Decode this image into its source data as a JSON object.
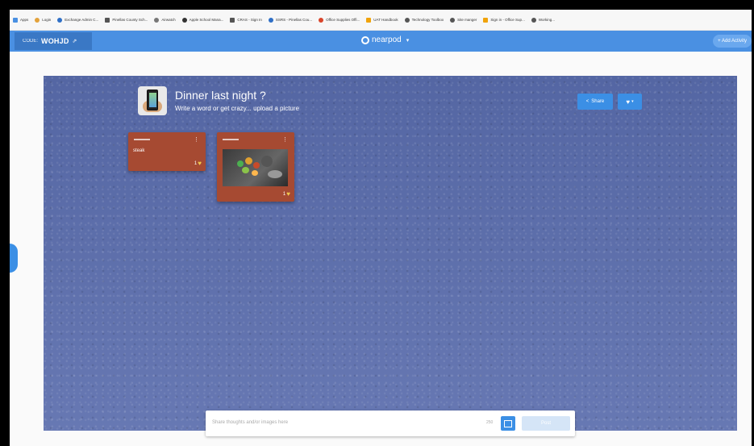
{
  "bookmarks": [
    {
      "label": "Apps",
      "color": "#4a90e2"
    },
    {
      "label": "Login",
      "color": "#e3a23b"
    },
    {
      "label": "Exchange Admin C...",
      "color": "#2f6fc6"
    },
    {
      "label": "Pinellas County Sch...",
      "color": "#555555"
    },
    {
      "label": "Airwatch",
      "color": "#777777"
    },
    {
      "label": "Apple School Mana...",
      "color": "#333333"
    },
    {
      "label": "CRAS - Sign In",
      "color": "#555555"
    },
    {
      "label": "SSRS - Pinellas Cou...",
      "color": "#2f6fc6"
    },
    {
      "label": "Office Supplies Offi...",
      "color": "#d9452b"
    },
    {
      "label": "UAT Handbook",
      "color": "#f0a30a"
    },
    {
      "label": "Technology Toolbox",
      "color": "#555555"
    },
    {
      "label": "Site manger",
      "color": "#555555"
    },
    {
      "label": "Sign in - Office Sup...",
      "color": "#f0a30a"
    },
    {
      "label": "Working...",
      "color": "#555555"
    }
  ],
  "topbar": {
    "code_label": "CODE:",
    "code_value": "WOHJD",
    "logo": "nearpod",
    "add_activity": "+ Add Activity"
  },
  "board": {
    "title": "Dinner last night ?",
    "subtitle": "Write a word or get crazy... upload a picture",
    "share_label": "Share"
  },
  "posts": [
    {
      "text": "steak",
      "likes": "1"
    },
    {
      "text": "",
      "likes": "1"
    }
  ],
  "input": {
    "placeholder": "Share thoughts and/or images here",
    "counter": "250",
    "post_label": "Post"
  },
  "colors": {
    "accent": "#4a90e2",
    "board": "#5b6da9",
    "post": "#a64a32"
  }
}
